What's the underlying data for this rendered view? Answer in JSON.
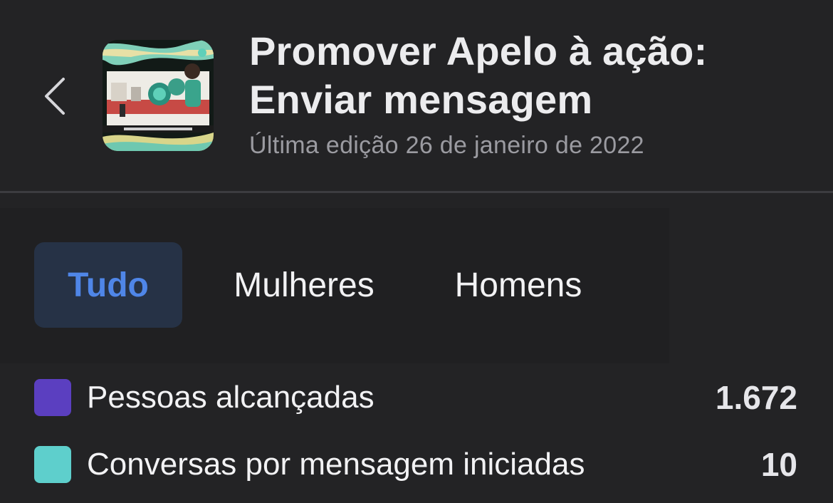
{
  "header": {
    "back_icon": "chevron-left-icon",
    "title_line1": "Promover Apelo à ação:",
    "title_line2": "Enviar mensagem",
    "subtitle": "Última edição 26 de janeiro de 2022"
  },
  "tabs": [
    {
      "label": "Tudo",
      "selected": true
    },
    {
      "label": "Mulheres",
      "selected": false
    },
    {
      "label": "Homens",
      "selected": false
    }
  ],
  "metrics": [
    {
      "label": "Pessoas alcançadas",
      "value": "1.672",
      "color": "#5b3fc0"
    },
    {
      "label": "Conversas por mensagem iniciadas",
      "value": "10",
      "color": "#5ecfcc"
    }
  ],
  "colors": {
    "background": "#232325",
    "accent": "#4f86e8",
    "selected_tab_bg": "#263246"
  }
}
